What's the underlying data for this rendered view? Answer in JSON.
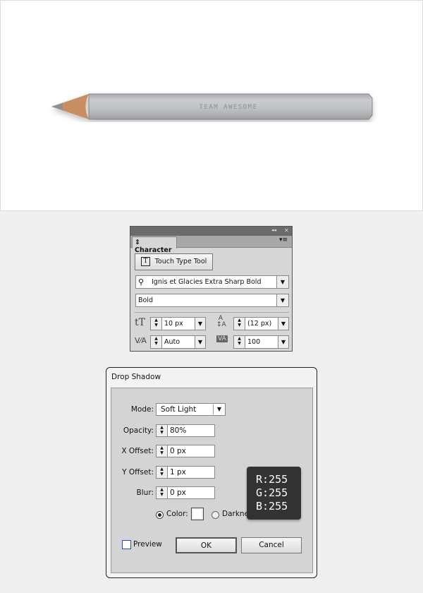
{
  "canvas": {
    "pencil_text": "TEAM AWESOME"
  },
  "character_panel": {
    "title_controls": {
      "collapse": "◂◂",
      "close": "✕"
    },
    "tab": "Character",
    "touch_type_button": "Touch Type Tool",
    "font_family": "Ignis et Glacies Extra Sharp Bold",
    "font_style": "Bold",
    "font_size": "10 px",
    "leading": "(12 px)",
    "kerning": "Auto",
    "tracking": "100"
  },
  "drop_shadow": {
    "title": "Drop Shadow",
    "mode_label": "Mode:",
    "mode": "Soft Light",
    "opacity_label": "Opacity:",
    "opacity": "80%",
    "x_offset_label": "X Offset:",
    "x_offset": "0 px",
    "y_offset_label": "Y Offset:",
    "y_offset": "1 px",
    "blur_label": "Blur:",
    "blur": "0 px",
    "color_label": "Color:",
    "color_selected": true,
    "color_swatch": "#ffffff",
    "darkness_label": "Darkne",
    "preview_label": "Preview",
    "preview_checked": false,
    "ok": "OK",
    "cancel": "Cancel"
  },
  "tooltip": {
    "r": "R:255",
    "g": "G:255",
    "b": "B:255"
  }
}
